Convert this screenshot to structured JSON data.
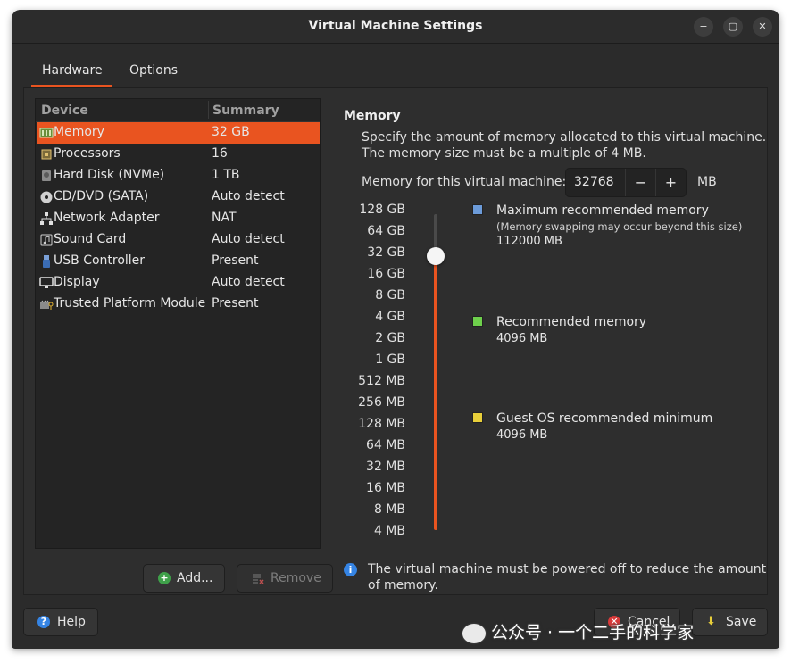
{
  "window": {
    "title": "Virtual Machine Settings",
    "controls": {
      "minimize": "−",
      "maximize": "▢",
      "close": "✕"
    }
  },
  "tabs": [
    {
      "label": "Hardware",
      "active": true
    },
    {
      "label": "Options",
      "active": false
    }
  ],
  "device_table": {
    "headers": {
      "device": "Device",
      "summary": "Summary"
    },
    "rows": [
      {
        "icon": "memory-icon",
        "name": "Memory",
        "summary": "32 GB",
        "selected": true
      },
      {
        "icon": "processor-icon",
        "name": "Processors",
        "summary": "16"
      },
      {
        "icon": "hard-disk-icon",
        "name": "Hard Disk (NVMe)",
        "summary": "1 TB"
      },
      {
        "icon": "cd-dvd-icon",
        "name": "CD/DVD (SATA)",
        "summary": "Auto detect"
      },
      {
        "icon": "network-adapter-icon",
        "name": "Network Adapter",
        "summary": "NAT"
      },
      {
        "icon": "sound-card-icon",
        "name": "Sound Card",
        "summary": "Auto detect"
      },
      {
        "icon": "usb-controller-icon",
        "name": "USB Controller",
        "summary": "Present"
      },
      {
        "icon": "display-icon",
        "name": "Display",
        "summary": "Auto detect"
      },
      {
        "icon": "tpm-icon",
        "name": "Trusted Platform Module",
        "summary": "Present"
      }
    ]
  },
  "device_buttons": {
    "add": "Add...",
    "remove": "Remove"
  },
  "memory": {
    "section_title": "Memory",
    "description": "Specify the amount of memory allocated to this virtual machine. The memory size must be a multiple of 4 MB.",
    "input_label": "Memory for this virtual machine:",
    "value": "32768",
    "unit": "MB",
    "decrement": "−",
    "increment": "+",
    "scale_ticks": [
      "128 GB",
      "64 GB",
      "32 GB",
      "16 GB",
      "8 GB",
      "4 GB",
      "2 GB",
      "1 GB",
      "512 MB",
      "256 MB",
      "128 MB",
      "64 MB",
      "32 MB",
      "16 MB",
      "8 MB",
      "4 MB"
    ],
    "slider_selected_tick": "32 GB",
    "legend": {
      "maximum": {
        "title": "Maximum recommended memory",
        "note": "(Memory swapping may occur beyond this size)",
        "value": "112000 MB",
        "color": "#6c9bd9"
      },
      "recommended": {
        "title": "Recommended memory",
        "value": "4096 MB",
        "color": "#6ed04c"
      },
      "minimum": {
        "title": "Guest OS recommended minimum",
        "value": "4096 MB",
        "color": "#e8cf3a"
      }
    },
    "info_text": "The virtual machine must be powered off to reduce the amount of memory."
  },
  "footer": {
    "help": "Help",
    "cancel": "Cancel",
    "save": "Save"
  },
  "watermark": {
    "text": "公众号 · 一个二手的科学家"
  },
  "colors": {
    "accent": "#e95420",
    "window_bg": "#2b2b2b",
    "list_bg": "#242424",
    "info_blue": "#3584e4"
  }
}
